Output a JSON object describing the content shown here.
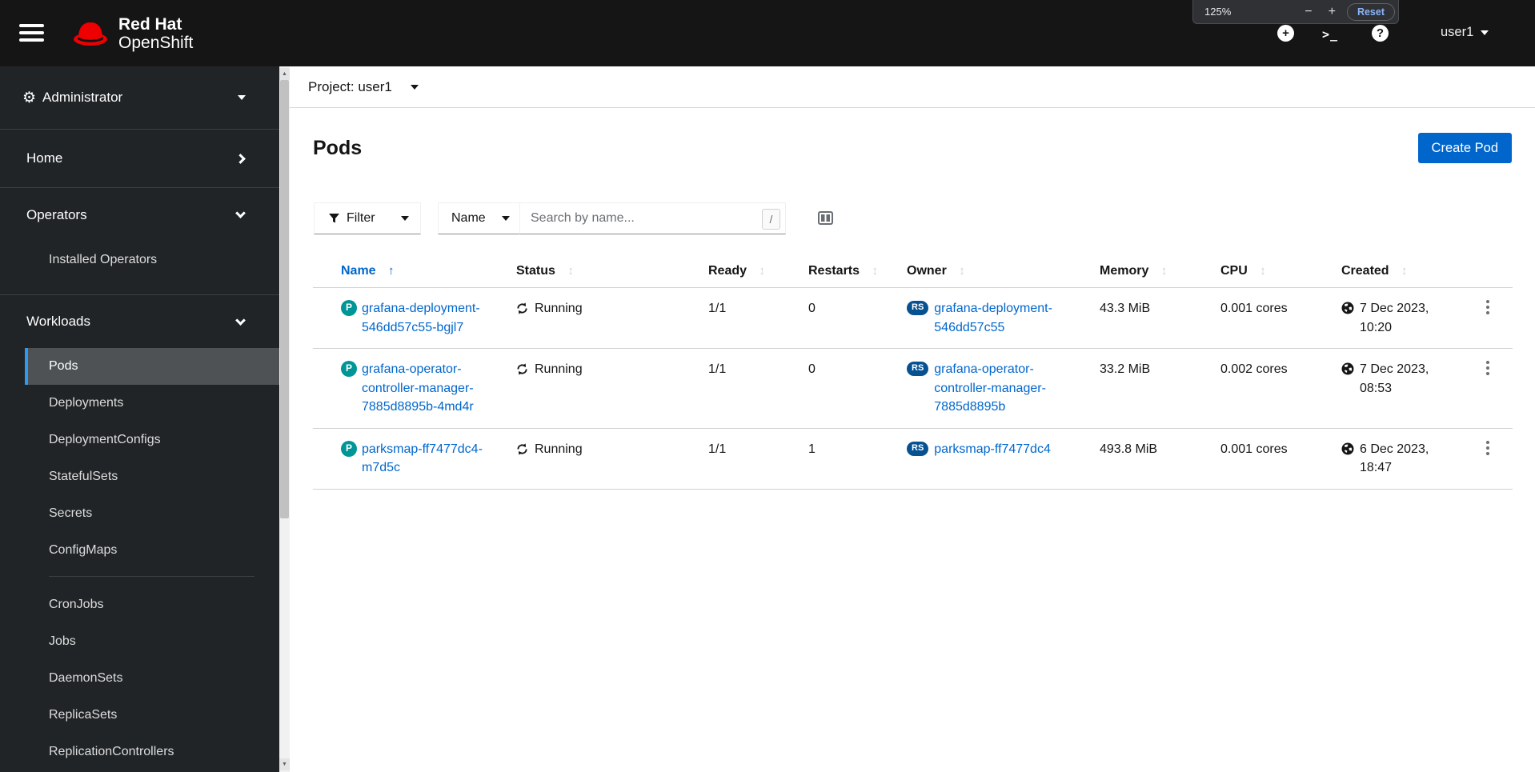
{
  "masthead": {
    "brand_line1": "Red Hat",
    "brand_line2": "OpenShift",
    "username": "user1",
    "plus_glyph": "+",
    "terminal_glyph": ">_",
    "question_glyph": "?"
  },
  "zoom_popup": {
    "level": "125%",
    "minus_label": "−",
    "plus_label": "+",
    "reset_label": "Reset"
  },
  "sidebar": {
    "perspective": "Administrator",
    "items": [
      {
        "label": "Home"
      },
      {
        "label": "Operators"
      },
      {
        "label": "Installed Operators"
      },
      {
        "label": "Workloads"
      },
      {
        "label": "Pods"
      },
      {
        "label": "Deployments"
      },
      {
        "label": "DeploymentConfigs"
      },
      {
        "label": "StatefulSets"
      },
      {
        "label": "Secrets"
      },
      {
        "label": "ConfigMaps"
      },
      {
        "label": "CronJobs"
      },
      {
        "label": "Jobs"
      },
      {
        "label": "DaemonSets"
      },
      {
        "label": "ReplicaSets"
      },
      {
        "label": "ReplicationControllers"
      }
    ],
    "selected_item": "Pods"
  },
  "project_bar": {
    "label": "Project: user1"
  },
  "page": {
    "title": "Pods",
    "create_button": "Create Pod"
  },
  "toolbar": {
    "filter_label": "Filter",
    "attribute_label": "Name",
    "search_placeholder": "Search by name...",
    "shortcut_key": "/"
  },
  "table": {
    "headers": [
      "Name",
      "Status",
      "Ready",
      "Restarts",
      "Owner",
      "Memory",
      "CPU",
      "Created"
    ],
    "sorted_by": "Name",
    "sort_direction": "ascending",
    "sort_glyph_active": "↑",
    "sort_glyph_inactive": "↕",
    "rows": [
      {
        "badge": "P",
        "name": "grafana-deployment-\n546dd57c55-bgjl7",
        "status": "Running",
        "ready": "1/1",
        "restarts": "0",
        "owner_badge": "RS",
        "owner": "grafana-deployment-\n546dd57c55",
        "memory": "43.3 MiB",
        "cpu": "0.001 cores",
        "created": "7 Dec 2023,\n10:20"
      },
      {
        "badge": "P",
        "name": "grafana-operator-\ncontroller-manager-\n7885d8895b-4md4r",
        "status": "Running",
        "ready": "1/1",
        "restarts": "0",
        "owner_badge": "RS",
        "owner": "grafana-operator-\ncontroller-manager-\n7885d8895b",
        "memory": "33.2 MiB",
        "cpu": "0.002 cores",
        "created": "7 Dec 2023,\n08:53"
      },
      {
        "badge": "P",
        "name": "parksmap-ff7477dc4-\nm7d5c",
        "status": "Running",
        "ready": "1/1",
        "restarts": "1",
        "owner_badge": "RS",
        "owner": "parksmap-ff7477dc4",
        "memory": "493.8 MiB",
        "cpu": "0.001 cores",
        "created": "6 Dec 2023,\n18:47"
      }
    ]
  },
  "colors": {
    "accent_blue": "#0066cc",
    "masthead_bg": "#151515",
    "sidebar_bg": "#212427",
    "nav_selected_bg": "#4f5255",
    "nav_selected_indicator": "#2b9af3",
    "pod_badge": "#009596",
    "replicaset_badge": "#085191",
    "brand_red": "#ee0000"
  }
}
